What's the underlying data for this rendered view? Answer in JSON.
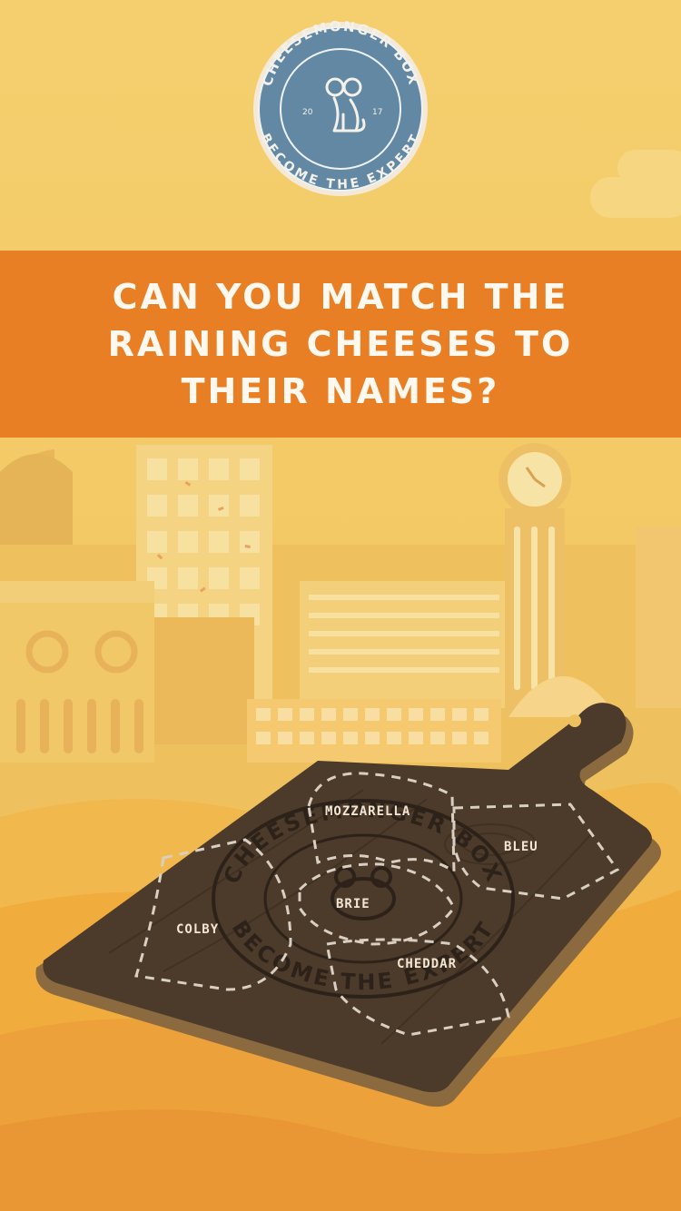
{
  "logo": {
    "ring_top": "CHEESEMONGER BOX",
    "ring_bottom": "BECOME THE EXPERT",
    "year_left": "20",
    "year_right": "17"
  },
  "banner": {
    "title": "Can you match the raining cheeses to their names?"
  },
  "board": {
    "engraving_top": "CHEESEMONGER BOX",
    "engraving_bottom": "BECOME THE EXPERT",
    "zones": [
      {
        "label": "MOZZARELLA"
      },
      {
        "label": "BLEU"
      },
      {
        "label": "BRIE"
      },
      {
        "label": "COLBY"
      },
      {
        "label": "CHEDDAR"
      }
    ]
  },
  "colors": {
    "sky": "#f3c966",
    "banner": "#e87f24",
    "logo_blue": "#6288a3",
    "board_wood": "#4c3a2a"
  }
}
